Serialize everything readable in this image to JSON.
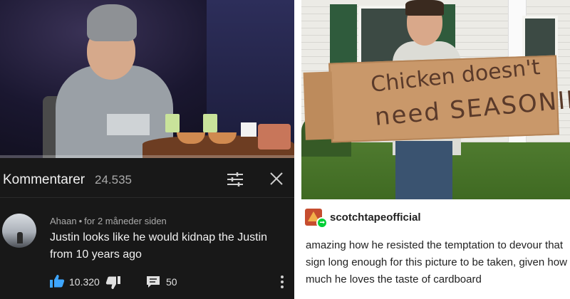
{
  "youtube": {
    "comments_title": "Kommentarer",
    "comments_count": "24.535",
    "progress_percent": 0,
    "comment": {
      "author": "Ahaan",
      "separator": "•",
      "time": "for 2 måneder siden",
      "text": "Justin looks like he would kidnap the Justin from 10 years ago",
      "likes": "10.320",
      "replies": "50"
    },
    "icons": [
      "sort-icon",
      "close-icon",
      "thumbs-up-icon",
      "thumbs-down-icon",
      "reply-icon",
      "more-vert-icon"
    ],
    "colors": {
      "background": "#181818",
      "text": "#f1f1f1",
      "secondary": "#aaaaaa",
      "like_accent": "#3ea6ff",
      "progress": "#ff0000"
    }
  },
  "tumblr": {
    "username": "scotchtapeofficial",
    "sign_line1": "Chicken doesn't",
    "sign_line2": "need SEASONING",
    "post_text": "amazing how he resisted the temptation to devour that sign long enough for this picture to be taken, given how much he loves the taste of cardboard",
    "colors": {
      "reblog": "#00cf35",
      "text": "#222222"
    }
  }
}
